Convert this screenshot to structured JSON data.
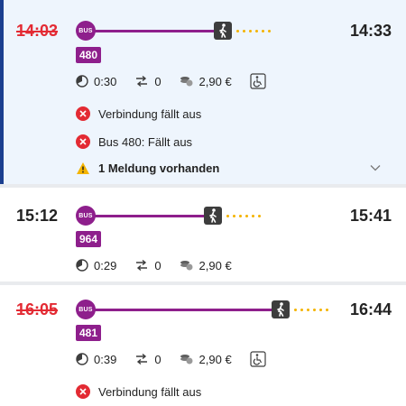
{
  "connections": [
    {
      "departure": "14:03",
      "departure_cancelled": true,
      "arrival": "14:33",
      "bus_label": "BUS",
      "line": "480",
      "duration": "0:30",
      "transfers": "0",
      "price": "2,90 €",
      "accessible": true,
      "messages": [
        "Verbindung fällt aus",
        "Bus 480: Fällt aus"
      ],
      "notice": "1 Meldung vorhanden",
      "selected": true
    },
    {
      "departure": "15:12",
      "departure_cancelled": false,
      "arrival": "15:41",
      "bus_label": "BUS",
      "line": "964",
      "duration": "0:29",
      "transfers": "0",
      "price": "2,90 €",
      "accessible": false,
      "messages": [],
      "selected": false
    },
    {
      "departure": "16:05",
      "departure_cancelled": true,
      "arrival": "16:44",
      "bus_label": "BUS",
      "line": "481",
      "duration": "0:39",
      "transfers": "0",
      "price": "2,90 €",
      "accessible": true,
      "messages": [
        "Verbindung fällt aus"
      ],
      "selected": false
    }
  ],
  "colors": {
    "bus": "#8e1f8c",
    "cancelled": "#e32a33",
    "walk_dots": "#f4b400",
    "selected_bg": "#eef5fd",
    "selected_bar": "#1b3f8f",
    "warning": "#f4b400"
  },
  "icons": {
    "duration": "duration-clock-icon",
    "transfers": "transfers-icon",
    "price": "coins-icon",
    "accessible": "wheelchair-icon",
    "walk": "walking-person-icon",
    "error": "error-x-icon",
    "warning": "warning-triangle-icon",
    "expand": "chevron-down-icon"
  }
}
